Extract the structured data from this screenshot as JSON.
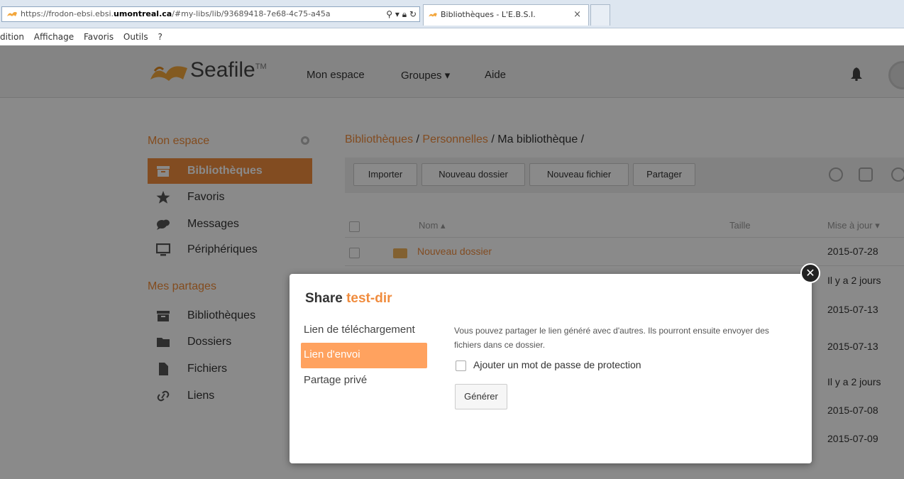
{
  "browser": {
    "url_scheme": "https://",
    "url_pre": "frodon-ebsi.ebsi.",
    "url_host": "umontreal.ca",
    "url_path": "/#my-libs/lib/93689418-7e68-4c75-a45a",
    "tab_title": "Bibliothèques - L'E.B.S.I.",
    "tab_close": "×",
    "menu": [
      "dition",
      "Affichage",
      "Favoris",
      "Outils",
      "?"
    ]
  },
  "app": {
    "logo_text": "Seafile",
    "logo_tm": "TM",
    "nav": [
      "Mon espace",
      "Groupes ▾",
      "Aide"
    ],
    "sidebar": {
      "my_space_title": "Mon espace",
      "my_space_items": [
        "Bibliothèques",
        "Favoris",
        "Messages",
        "Périphériques"
      ],
      "shares_title": "Mes partages",
      "shares_items": [
        "Bibliothèques",
        "Dossiers",
        "Fichiers",
        "Liens"
      ]
    },
    "breadcrumb": {
      "part1": "Bibliothèques",
      "sep1": " / ",
      "part2": "Personnelles",
      "rest": " / Ma bibliothèque /"
    },
    "toolbar": [
      "Importer",
      "Nouveau dossier",
      "Nouveau fichier",
      "Partager"
    ],
    "table": {
      "headers": [
        "Nom ▴",
        "Taille",
        "Mise à jour ▾"
      ],
      "first_row_name": "Nouveau dossier",
      "dates": [
        "2015-07-28",
        "Il y a 2 jours",
        "2015-07-13",
        "2015-07-13",
        "Il y a 2 jours",
        "2015-07-08",
        "2015-07-09"
      ]
    }
  },
  "dialog": {
    "title_prefix": "Share ",
    "title_object": "test-dir",
    "close_glyph": "✕",
    "nav": [
      "Lien de téléchargement",
      "Lien d'envoi",
      "Partage privé"
    ],
    "description": "Vous pouvez partager le lien généré avec d'autres. Ils pourront ensuite envoyer des fichiers dans ce dossier.",
    "checkbox_label": "Ajouter un mot de passe de protection",
    "button_label": "Générer"
  }
}
